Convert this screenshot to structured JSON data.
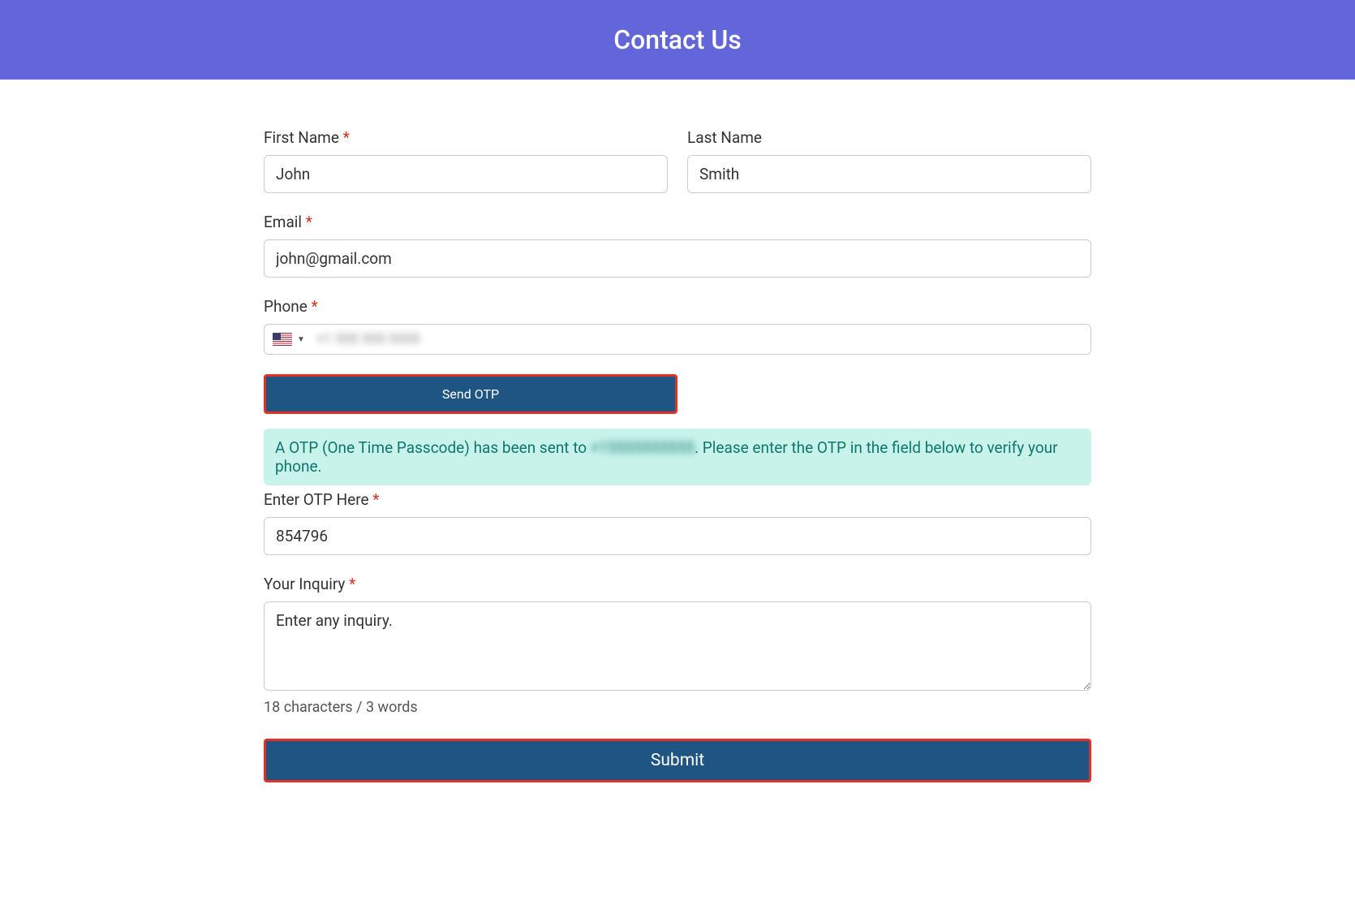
{
  "header": {
    "title": "Contact Us"
  },
  "form": {
    "first_name": {
      "label": "First Name ",
      "value": "John"
    },
    "last_name": {
      "label": "Last Name",
      "value": "Smith"
    },
    "email": {
      "label": "Email ",
      "value": "john@gmail.com"
    },
    "phone": {
      "label": "Phone ",
      "blurred": "+1 555 555 5555"
    },
    "send_otp_label": "Send OTP",
    "otp_message_before": "A OTP (One Time Passcode) has been sent to ",
    "otp_message_blurred": "+15555555555",
    "otp_message_after": ". Please enter the OTP in the field below to verify your phone.",
    "otp": {
      "label": "Enter OTP Here ",
      "value": "854796"
    },
    "inquiry": {
      "label": "Your Inquiry ",
      "value": "Enter any inquiry."
    },
    "counter": "18 characters / 3 words",
    "submit_label": "Submit",
    "asterisk": "*"
  }
}
